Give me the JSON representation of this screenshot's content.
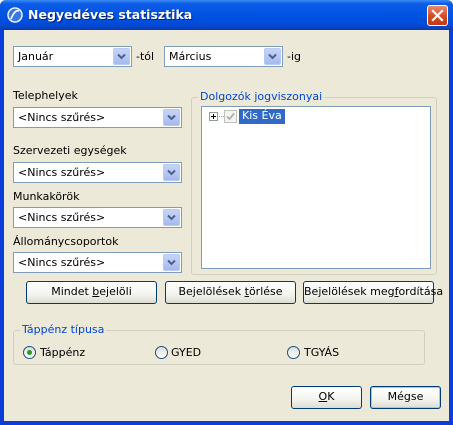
{
  "window": {
    "title": "Negyedéves statisztika"
  },
  "period": {
    "from_value": "Január",
    "from_suffix": "-tól",
    "to_value": "Március",
    "to_suffix": "-ig"
  },
  "filters": {
    "sites_label": "Telephelyek",
    "sites_value": "<Nincs szűrés>",
    "org_units_label": "Szervezeti egységek",
    "org_units_value": "<Nincs szűrés>",
    "jobs_label": "Munkakörök",
    "jobs_value": "<Nincs szűrés>",
    "staff_groups_label": "Állománycsoportok",
    "staff_groups_value": "<Nincs szűrés>"
  },
  "employees": {
    "group_title": "Dolgozók jogviszonyai",
    "items": [
      {
        "label": "Kis Éva",
        "checked": true,
        "selected": true
      }
    ]
  },
  "actions": {
    "select_all_pre": "Mindet ",
    "select_all_key": "b",
    "select_all_post": "ejelöli",
    "clear_pre": "Bejelölések ",
    "clear_key": "t",
    "clear_post": "örlése",
    "invert_pre": "Bejelölések meg",
    "invert_key": "f",
    "invert_post": "ordítása"
  },
  "sick_pay": {
    "group_title": "Táppénz típusa",
    "options": [
      {
        "label": "Táppénz",
        "selected": true
      },
      {
        "label": "GYED",
        "selected": false
      },
      {
        "label": "TGYÁS",
        "selected": false
      }
    ]
  },
  "footer": {
    "ok_key": "O",
    "ok_post": "K",
    "cancel_label": "Mégse"
  }
}
